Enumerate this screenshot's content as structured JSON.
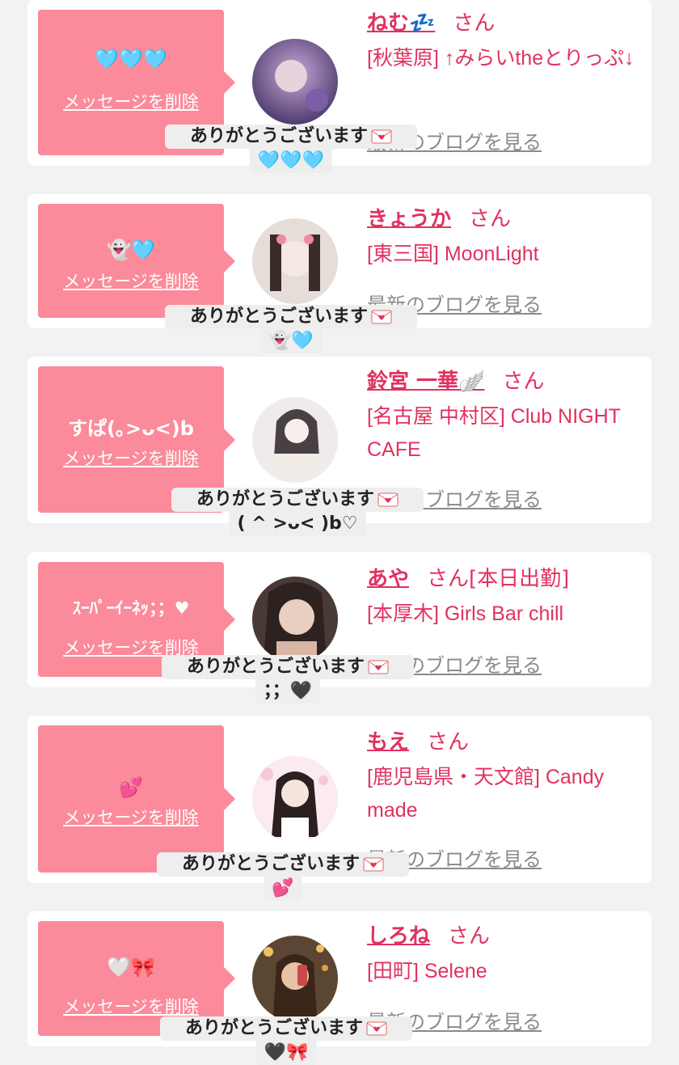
{
  "common": {
    "delete_label": "メッセージを削除",
    "blog_label": "最新のブログを見る",
    "honorific": "さん",
    "thanks_text": "ありがとうございます"
  },
  "cards": [
    {
      "bubble_text": "🩵🩵🩵",
      "name": "ねむ💤",
      "honorific_suffix": "",
      "shop": "[秋葉原] ↑みらいtheとりっぷ↓",
      "reply_second": "🩵🩵🩵",
      "avatar_colors": [
        "#3a2a5c",
        "#c8a8d8"
      ]
    },
    {
      "bubble_text": "👻🩵",
      "name": "きょうか",
      "honorific_suffix": "",
      "shop": "[東三国] MoonLight",
      "reply_second": "👻🩵",
      "avatar_colors": [
        "#d8d0cc",
        "#f0e6e2"
      ]
    },
    {
      "bubble_text": "すぱ(｡>ᴗ<)b",
      "name": "鈴宮 一華🪽",
      "honorific_suffix": "",
      "shop": "[名古屋 中村区] Club NIGHT CAFE",
      "reply_second": "( ^ >ᴗ< )b♡",
      "avatar_colors": [
        "#e8e6ea",
        "#f6f4f6"
      ]
    },
    {
      "bubble_text": "ｽｰﾊﾟｰｲｰﾈｯ；；♥",
      "name": "あや",
      "honorific_suffix": "[本日出勤]",
      "shop": "[本厚木] Girls Bar chill",
      "reply_second": "；；🖤",
      "avatar_colors": [
        "#3a2c2a",
        "#d8b6a6"
      ]
    },
    {
      "bubble_text": "💕",
      "name": "もえ",
      "honorific_suffix": "",
      "shop": "[鹿児島県・天文館] Candy made",
      "reply_second": "💕",
      "avatar_colors": [
        "#f6e2e8",
        "#fdf2f5"
      ]
    },
    {
      "bubble_text": "🤍🎀",
      "name": "しろね",
      "honorific_suffix": "",
      "shop": "[田町] Selene",
      "reply_second": "🖤🎀",
      "avatar_colors": [
        "#4a3a2c",
        "#c89a70"
      ]
    }
  ],
  "colors": {
    "accent": "#e0325f",
    "bubble": "#fb8a9a",
    "background": "#f2f2f2",
    "card": "#ffffff",
    "link_gray": "#8a8a8a"
  },
  "icons": {
    "mail": "love-letter-icon"
  }
}
